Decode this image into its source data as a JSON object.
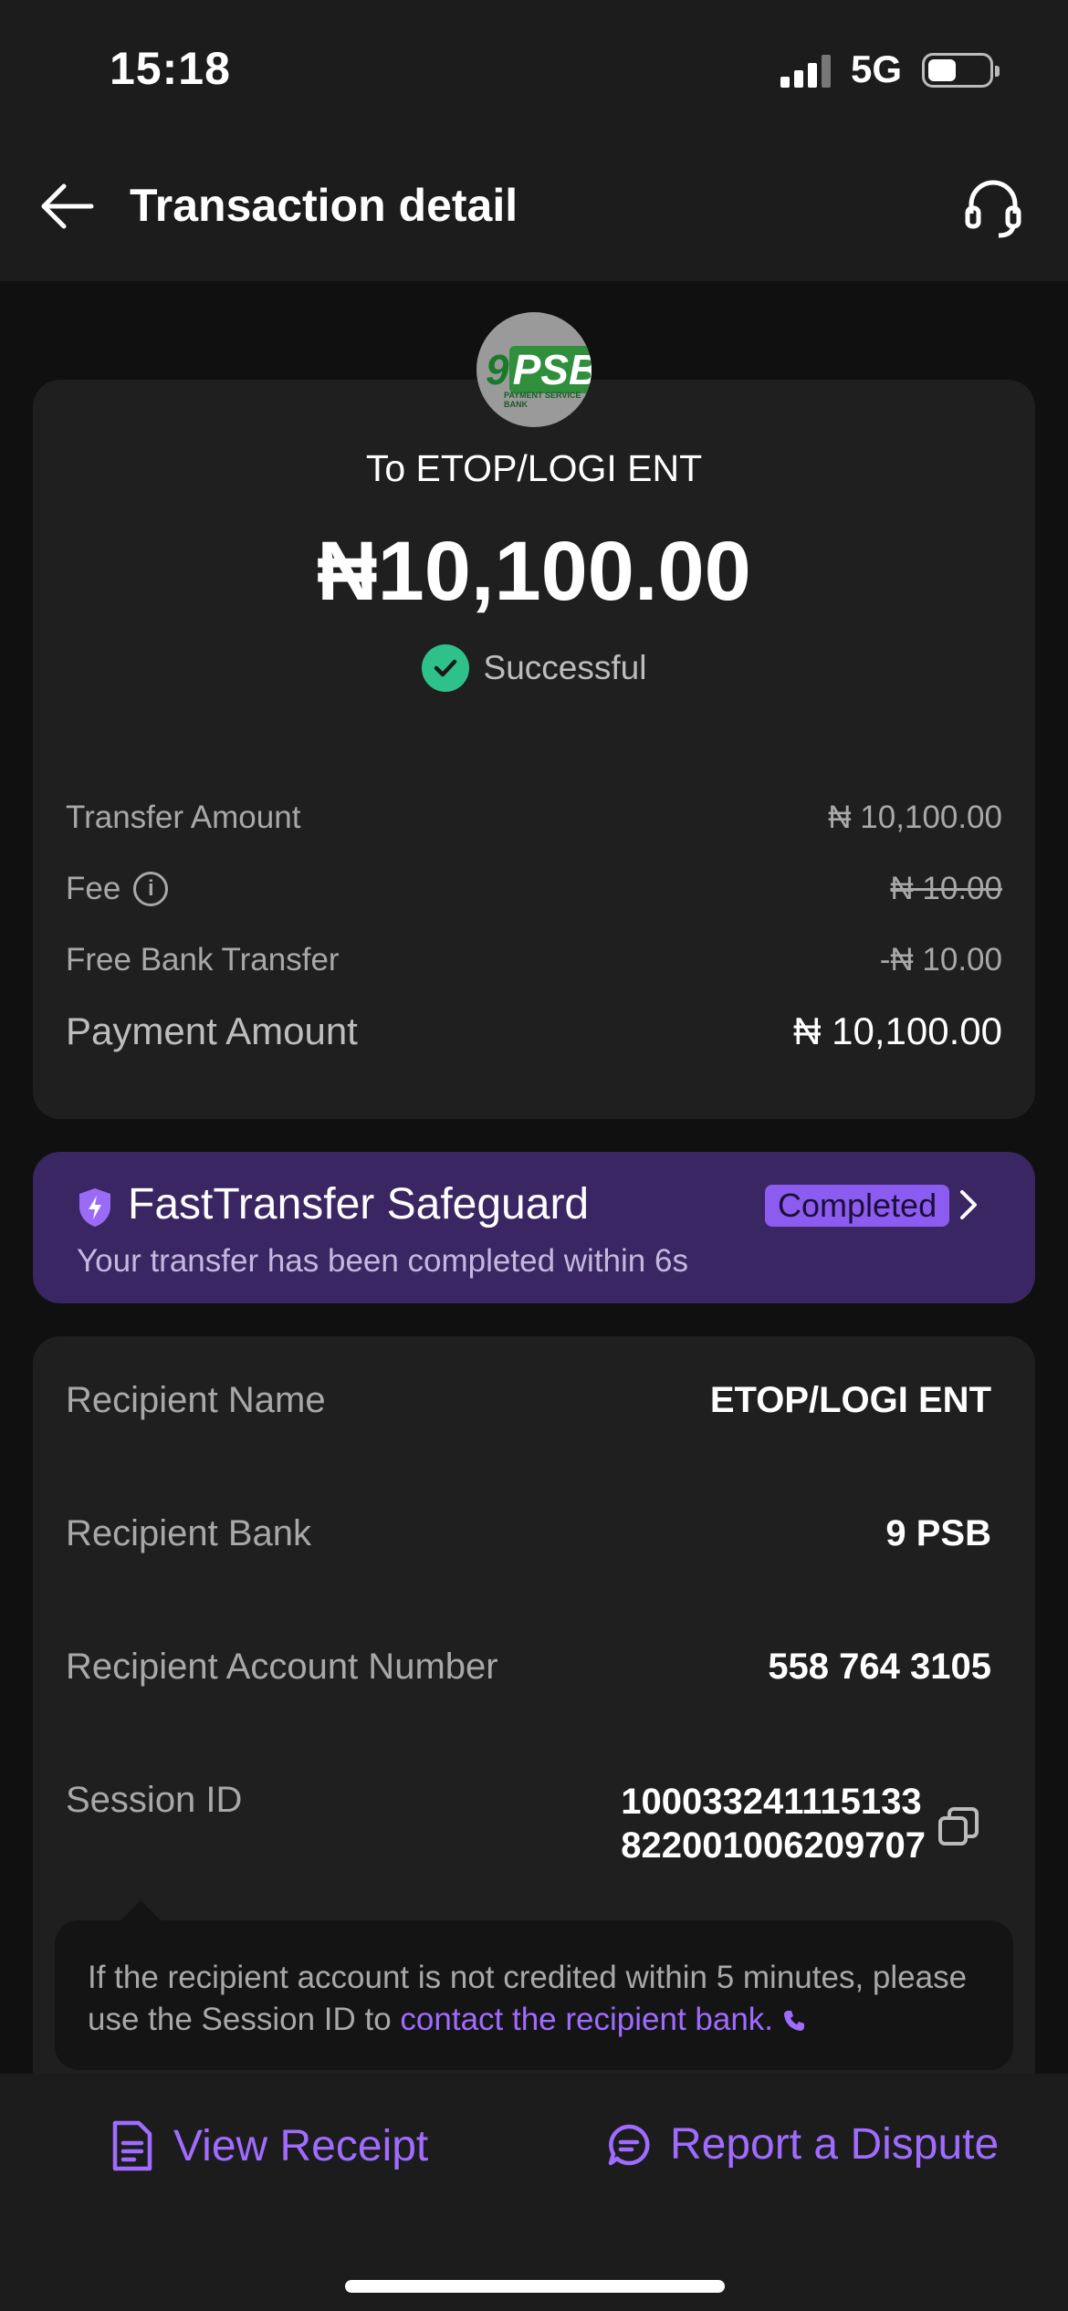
{
  "status_bar": {
    "time": "15:18",
    "network": "5G"
  },
  "header": {
    "title": "Transaction detail"
  },
  "transaction": {
    "to_label": "To ETOP/LOGI ENT",
    "amount": "₦10,100.00",
    "status": "Successful",
    "logo_text": "9PSB",
    "logo_subtext": "PAYMENT SERVICE BANK"
  },
  "breakdown": [
    {
      "label": "Transfer Amount",
      "value": "₦ 10,100.00"
    },
    {
      "label": "Fee",
      "value": "₦ 10.00"
    },
    {
      "label": "Free Bank Transfer",
      "value": "-₦ 10.00"
    },
    {
      "label": "Payment Amount",
      "value": "₦ 10,100.00"
    }
  ],
  "safeguard": {
    "title": "FastTransfer Safeguard",
    "badge": "Completed",
    "subtitle": "Your transfer has been completed within 6s"
  },
  "recipient": {
    "name_label": "Recipient Name",
    "name_value": "ETOP/LOGI ENT",
    "bank_label": "Recipient Bank",
    "bank_value": "9 PSB",
    "account_label": "Recipient Account Number",
    "account_value": "558 764 3105",
    "session_label": "Session ID",
    "session_line1": "100033241115133",
    "session_line2": "822001006209707"
  },
  "tooltip": {
    "text": "If the recipient account is not credited within 5 minutes, please use the Session ID to ",
    "link": "contact the recipient bank."
  },
  "actions": {
    "receipt": "View Receipt",
    "dispute": "Report a Dispute"
  },
  "colors": {
    "accent": "#a06bff",
    "success": "#2ec28a",
    "banner": "#3a2663"
  }
}
